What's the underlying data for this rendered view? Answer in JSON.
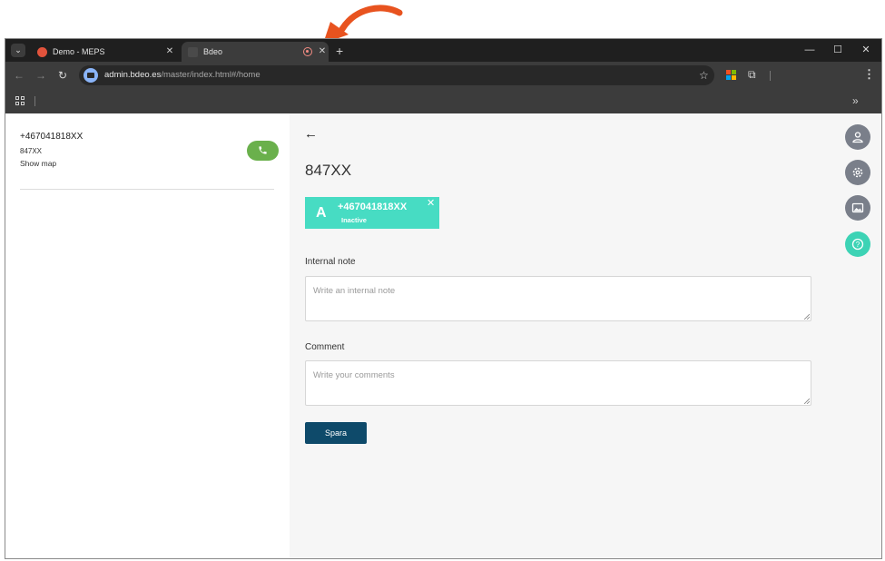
{
  "browser": {
    "tabs": [
      {
        "title": "Demo - MEPS",
        "active": false
      },
      {
        "title": "Bdeo",
        "active": true,
        "recording": true
      }
    ],
    "url_host": "admin.bdeo.es",
    "url_path": "/master/index.html#/home"
  },
  "left_panel": {
    "phone": "+467041818XX",
    "plate": "847XX",
    "show_map": "Show map",
    "call_color": "#6ab04c"
  },
  "detail": {
    "title": "847XX",
    "chip": {
      "letter": "A",
      "number": "+467041818XX",
      "status": "Inactive",
      "color": "#47dcc3"
    },
    "internal_note": {
      "label": "Internal note",
      "placeholder": "Write an internal note"
    },
    "comment": {
      "label": "Comment",
      "placeholder": "Write your comments"
    },
    "save_label": "Spara",
    "save_color": "#0e4a6a"
  },
  "fabs": [
    "user-icon",
    "settings-icon",
    "gallery-icon",
    "help-icon"
  ],
  "annotation_color": "#e8531f"
}
